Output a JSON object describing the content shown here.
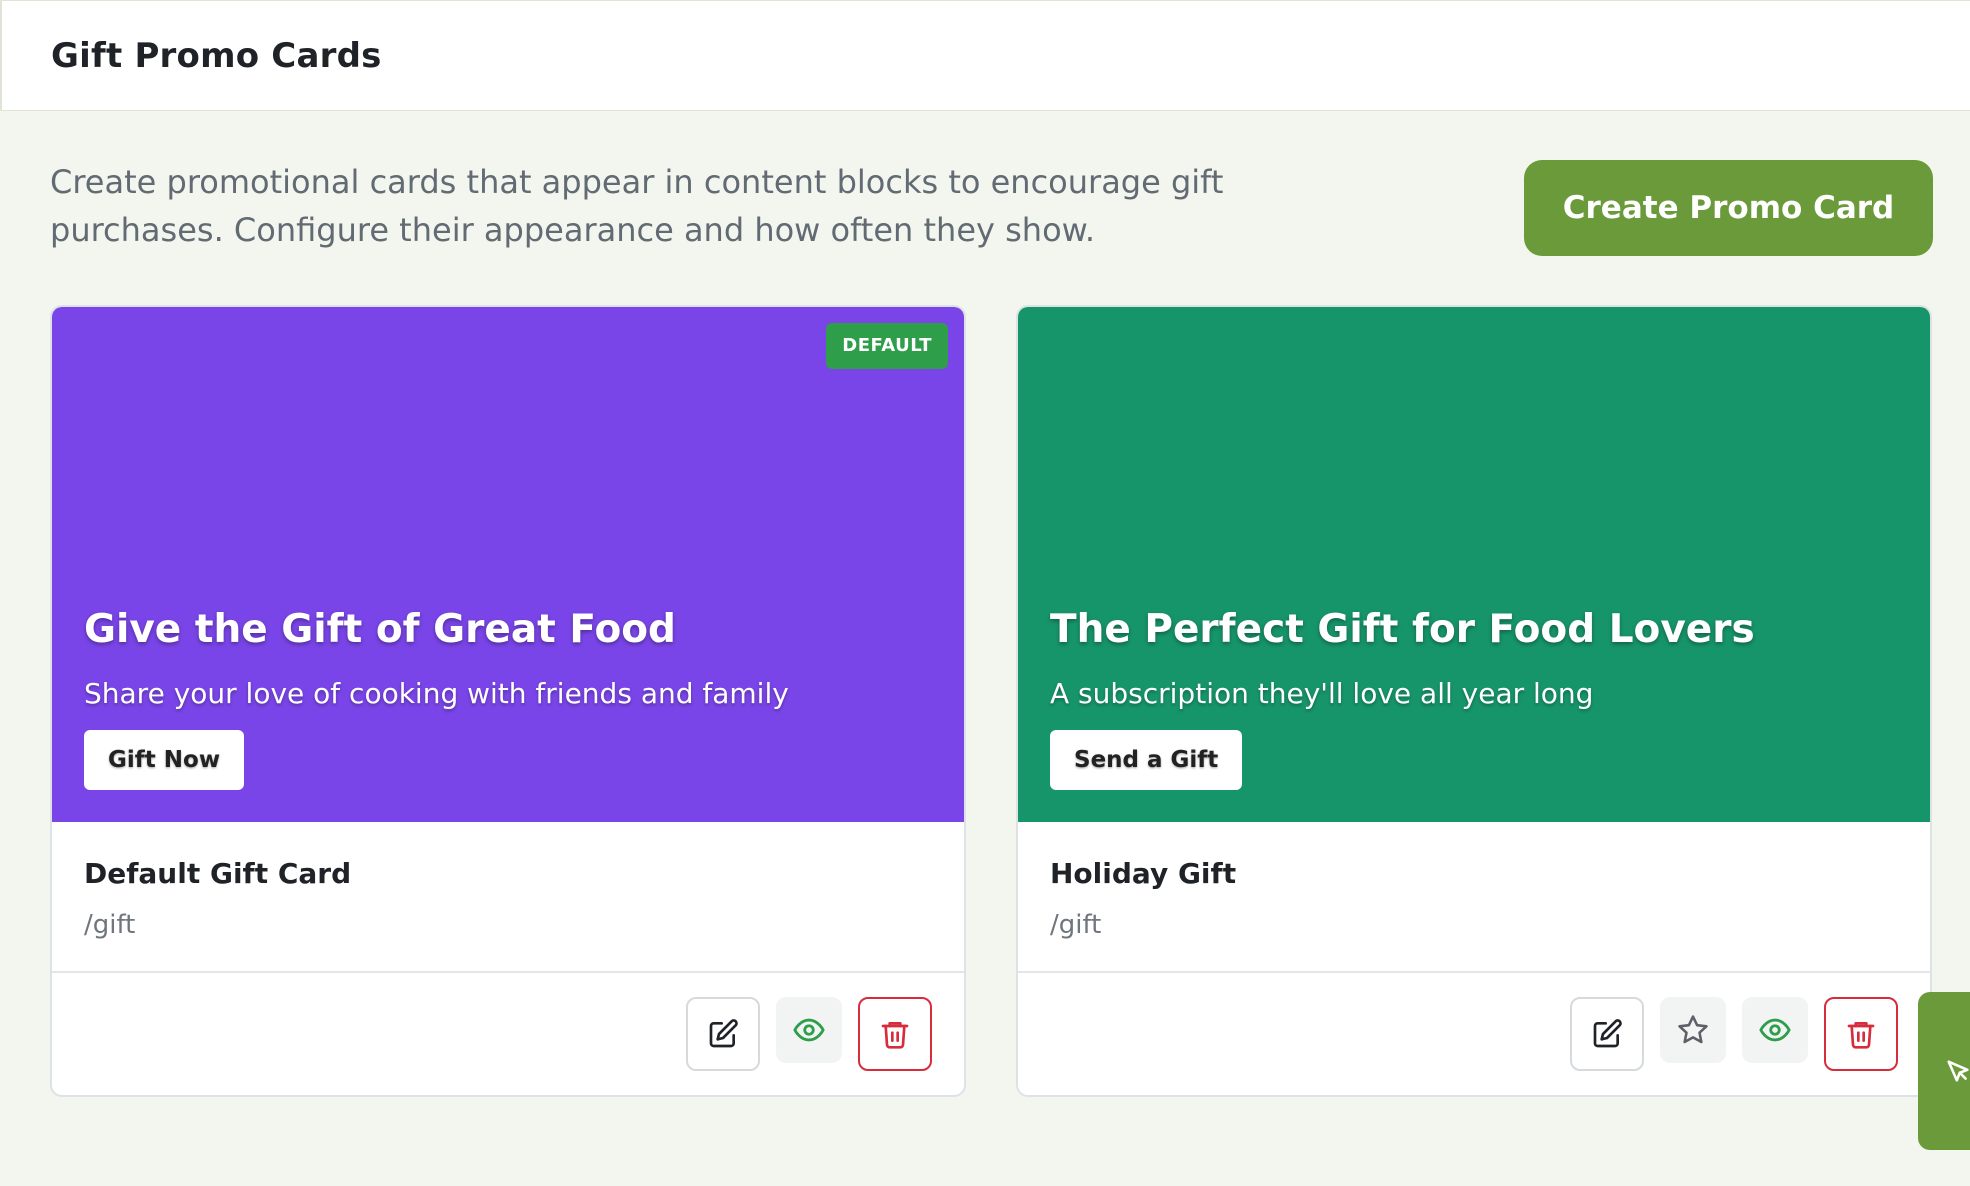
{
  "header": {
    "title": "Gift Promo Cards"
  },
  "intro": {
    "description": "Create promotional cards that appear in content blocks to encourage gift purchases. Configure their appearance and how often they show.",
    "create_label": "Create Promo Card"
  },
  "colors": {
    "accent": "#6a9a3a",
    "card1_bg": "#7a45e8",
    "card2_bg": "#17956a",
    "badge": "#2e9e4a",
    "danger": "#d62c3b",
    "eye": "#2e9e4a"
  },
  "cards": [
    {
      "badge": "DEFAULT",
      "banner_title": "Give the Gift of Great Food",
      "banner_subtitle": "Share your love of cooking with friends and family",
      "button_label": "Gift Now",
      "name": "Default Gift Card",
      "path": "/gift",
      "actions": [
        "edit-icon",
        "eye-icon",
        "trash-icon"
      ]
    },
    {
      "banner_title": "The Perfect Gift for Food Lovers",
      "banner_subtitle": "A subscription they'll love all year long",
      "button_label": "Send a Gift",
      "name": "Holiday Gift",
      "path": "/gift",
      "actions": [
        "edit-icon",
        "star-icon",
        "eye-icon",
        "trash-icon"
      ]
    }
  ],
  "side_tab": {
    "icon": "cursor-arrow-icon"
  }
}
